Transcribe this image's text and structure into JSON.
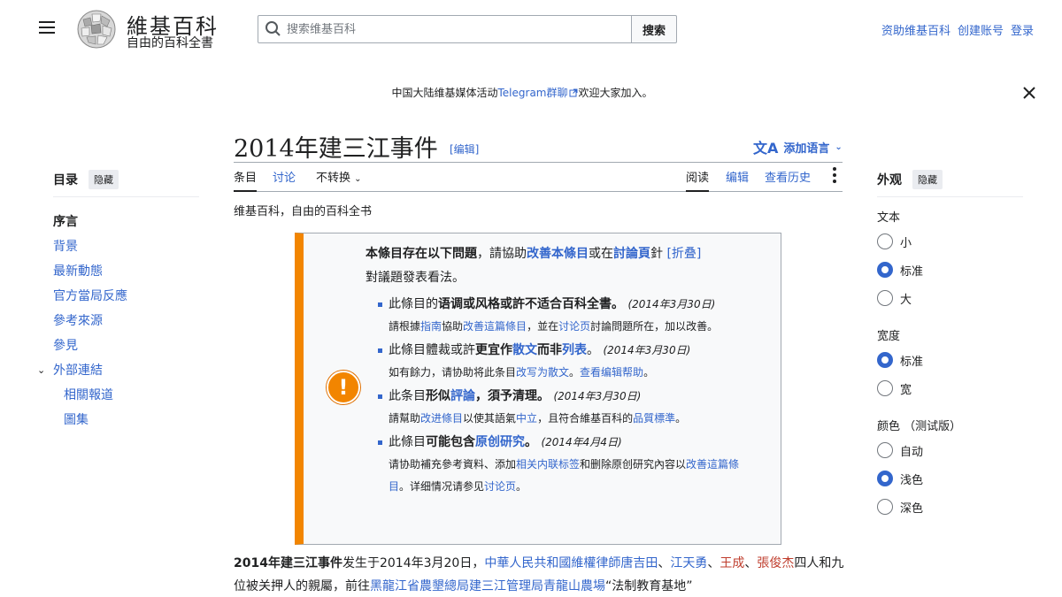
{
  "header": {
    "wordmark": "維基百科",
    "tagline": "自由的百科全書",
    "search_placeholder": "搜索维基百科",
    "search_button": "搜索",
    "user_links": [
      "资助维基百科",
      "创建账号",
      "登录"
    ]
  },
  "banner": {
    "prefix": "中国大陆维基媒体活动",
    "link": "Telegram群聊",
    "suffix": "欢迎大家加入。"
  },
  "toc": {
    "title": "目录",
    "hide": "隐藏",
    "items": [
      "序言",
      "背景",
      "最新動態",
      "官方當局反應",
      "參考來源",
      "參見",
      "外部連結",
      "相關報道",
      "圖集"
    ]
  },
  "article": {
    "title": "2014年建三江事件",
    "edit": "[编辑]",
    "add_languages": "添加语言",
    "tabs_left": [
      "条目",
      "讨论",
      "不转换"
    ],
    "tabs_right": [
      "阅读",
      "编辑",
      "查看历史"
    ],
    "site_sub": "维基百科，自由的百科全书"
  },
  "ambox": {
    "head_bold": "本條目存在以下問題",
    "head_mid": "，請協助",
    "head_link1": "改善本條目",
    "head_mid2": "或在",
    "head_link2": "討論頁",
    "head_mid3": "針",
    "head_fold": "[折叠]",
    "head_line2": "對議題發表看法。",
    "issue1_pre": "此條目的",
    "issue1_bold": "语调或风格或許不适合百科全書",
    "issue1_end": "。",
    "issue1_date": "(2014年3月30日)",
    "issue1_adv_1": "請根據",
    "issue1_adv_l1": "指南",
    "issue1_adv_2": "協助",
    "issue1_adv_l2": "改善這篇條目",
    "issue1_adv_3": "，並在",
    "issue1_adv_l3": "讨论页",
    "issue1_adv_4": "討論問題所在，加以改善。",
    "issue2_pre": "此條目體裁或許",
    "issue2_bold1": "更宜作",
    "issue2_link1": "散文",
    "issue2_bold2": "而非",
    "issue2_link2": "列表",
    "issue2_end": "。",
    "issue2_date": "(2014年3月30日)",
    "issue2_adv_1": "如有餘力，请协助将此条目",
    "issue2_adv_l1": "改写为散文",
    "issue2_adv_2": "。",
    "issue2_adv_l2": "查看编辑帮助",
    "issue2_adv_3": "。",
    "issue3_pre": "此条目",
    "issue3_bold1": "形似",
    "issue3_link1": "評論",
    "issue3_bold2": "，須予清理",
    "issue3_end": "。",
    "issue3_date": "(2014年3月30日)",
    "issue3_adv_1": "請幫助",
    "issue3_adv_l1": "改进條目",
    "issue3_adv_2": "以使其語氣",
    "issue3_adv_l2": "中立",
    "issue3_adv_3": "，且符合維基百科的",
    "issue3_adv_l3": "品質標準",
    "issue3_adv_4": "。",
    "issue4_pre": "此條目",
    "issue4_bold1": "可能包含",
    "issue4_link1": "原创研究",
    "issue4_end": "。",
    "issue4_date": "(2014年4月4日)",
    "issue4_adv_1": "请协助補充參考資料、添加",
    "issue4_adv_l1": "相关内联标签",
    "issue4_adv_2": "和删除原创研究內容以",
    "issue4_adv_l2": "改善這篇條目",
    "issue4_adv_3": "。详细情况请参见",
    "issue4_adv_l3": "讨论页",
    "issue4_adv_4": "。"
  },
  "appearance": {
    "title": "外观",
    "hide": "隐藏",
    "text_label": "文本",
    "text_options": [
      "小",
      "标准",
      "大"
    ],
    "width_label": "宽度",
    "width_options": [
      "标准",
      "宽"
    ],
    "color_label": "颜色 （测试版）",
    "color_options": [
      "自动",
      "浅色",
      "深色"
    ]
  },
  "lead": {
    "bold": "2014年建三江事件",
    "t1": "发生于2014年3月20日，",
    "l1": "中華人民共和國維權律師唐吉田",
    "t2": "、",
    "l2": "江天勇",
    "t3": "、",
    "l3": "王成",
    "t4": "、",
    "l4": "張俊杰",
    "t5": "四人和九位被关押人的親屬，前往",
    "l5": "黑龍江省農墾總局建三江管理局青龍山農場",
    "t6": "“法制教育基地”"
  },
  "colors": {
    "accent": "#3366cc",
    "warning": "#f28500",
    "redlink": "#bf3c2c"
  }
}
